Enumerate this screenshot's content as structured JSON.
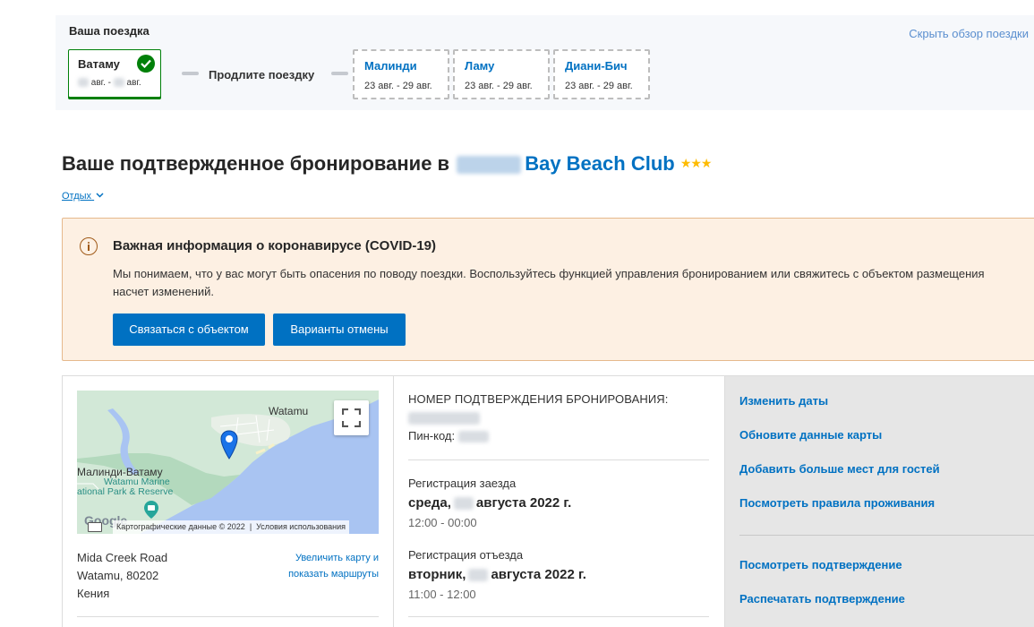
{
  "trip": {
    "title": "Ваша поездка",
    "hide_link": "Скрыть обзор поездки",
    "current": {
      "name": "Ватаму",
      "dates_mid": "авг. -",
      "dates_end": "авг."
    },
    "extend_label": "Продлите поездку",
    "suggestions": [
      {
        "name": "Малинди",
        "dates": "23 авг. - 29 авг."
      },
      {
        "name": "Ламу",
        "dates": "23 авг. - 29 авг."
      },
      {
        "name": "Диани-Бич",
        "dates": "23 авг. - 29 авг."
      }
    ]
  },
  "heading": {
    "prefix": "Ваше подтвержденное бронирование в",
    "hotel": "Bay Beach Club",
    "stars": "★★★",
    "holiday_link": "Отдых"
  },
  "covid": {
    "title": "Важная информация о коронавирусе (COVID-19)",
    "text": "Мы понимаем, что у вас могут быть опасения по поводу поездки. Воспользуйтесь функцией управления бронированием или свяжитесь с объектом размещения насчет изменений.",
    "contact_button": "Связаться с объектом",
    "cancel_button": "Варианты отмены"
  },
  "map": {
    "town_label": "Watamu",
    "area_label": "Малинди-Ватаму",
    "park_line1": "Watamu Marine",
    "park_line2": "ational Park & Reserve",
    "logo": "Google",
    "attribution": "Картографические данные © 2022",
    "terms": "Условия использования",
    "enlarge_link": "Увеличить карту и показать маршруты"
  },
  "address": {
    "line1": "Mida Creek Road",
    "line2": "Watamu, 80202",
    "line3": "Кения"
  },
  "booking": {
    "conf_label": "НОМЕР ПОДТВЕРЖДЕНИЯ БРОНИРОВАНИЯ:",
    "pin_label": "Пин-код:",
    "checkin_label": "Регистрация заезда",
    "checkin_day": "среда,",
    "checkin_month": "августа 2022 г.",
    "checkin_time": "12:00 - 00:00",
    "checkout_label": "Регистрация отъезда",
    "checkout_day": "вторник,",
    "checkout_month": "августа 2022 г.",
    "checkout_time": "11:00 - 12:00"
  },
  "actions": {
    "change_dates": "Изменить даты",
    "update_card": "Обновите данные карты",
    "add_guests": "Добавить больше мест для гостей",
    "view_rules": "Посмотреть правила проживания",
    "view_confirmation": "Посмотреть подтверждение",
    "print_confirmation": "Распечатать подтверждение"
  },
  "colors": {
    "brand_blue": "#0071c2",
    "success_green": "#008009",
    "notice_bg": "#fdf0e3",
    "star": "#febb02"
  }
}
